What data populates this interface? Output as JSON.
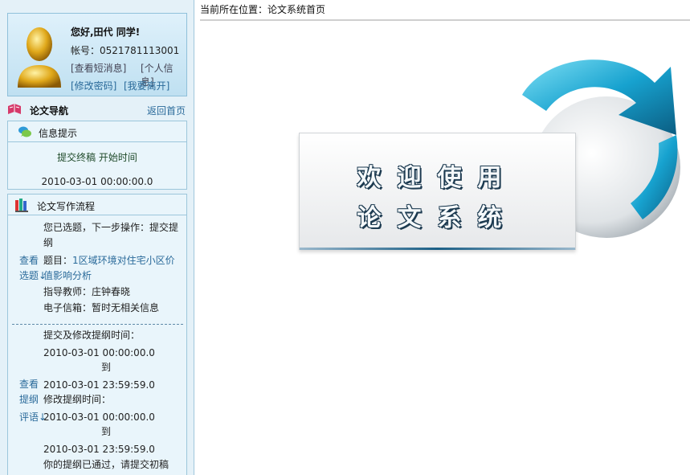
{
  "user": {
    "greeting": "您好,田代 同学!",
    "account": "帐号：0521781113001",
    "view_messages": "[查看短消息]",
    "personal_info": "[个人信息]",
    "change_password": "[修改密码]",
    "logout": "[我要离开]"
  },
  "nav": {
    "title": "论文导航",
    "back_home": "返回首页"
  },
  "info_panel": {
    "title": "信息提示",
    "line1": "提交终稿  开始时间",
    "line2": "2010-03-01 00:00:00.0"
  },
  "flow_panel": {
    "title": "论文写作流程",
    "status_line1": "您已选题，下一步操作：提交提",
    "status_line2": "纲",
    "view_topic_1": "查看",
    "view_topic_2": "选题↓",
    "topic_label": "题目：",
    "topic_value_1": "1区域环境对住宅小区价",
    "topic_value_2": "值影响分析",
    "advisor": "指导教师：庄钟春晓",
    "email": "电子信箱：暂时无相关信息",
    "outline_time_label": "提交及修改提纲时间：",
    "outline_start": "2010-03-01 00:00:00.0",
    "to_1": "到",
    "outline_end": "2010-03-01 23:59:59.0",
    "revise_label": "修改提纲时间：",
    "revise_start": "2010-03-01 00:00:00.0",
    "to_2": "到",
    "revise_end": "2010-03-01 23:59:59.0",
    "outline_passed": "你的提纲已通过，请提交初稿",
    "view_outline_1": "查看",
    "view_outline_2": "提纲",
    "view_outline_3": "评语↓"
  },
  "main": {
    "location": "当前所在位置：论文系统首页",
    "welcome_line1": "欢迎使用",
    "welcome_line2": "论文系统"
  },
  "icons": {
    "avatar": "user-avatar-icon",
    "nav": "book-icon",
    "info": "chat-bubbles-icon",
    "flow": "books-icon",
    "art": "circular-arrow-icon"
  },
  "colors": {
    "link": "#2a6a9a",
    "panel_bg": "#e9f5fb",
    "panel_border": "#9cc6db",
    "accent": "#1b8fbf"
  }
}
